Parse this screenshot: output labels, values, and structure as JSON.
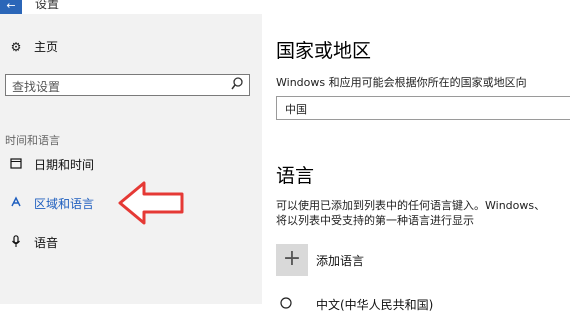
{
  "titlebar": {
    "back_icon": "←",
    "title": "设置"
  },
  "sidebar": {
    "home": {
      "icon": "gear-icon",
      "label": "主页"
    },
    "search_placeholder": "查找设置",
    "section": "时间和语言",
    "items": [
      {
        "icon": "calendar-clock-icon",
        "label": "日期和时间"
      },
      {
        "icon": "region-language-icon",
        "label": "区域和语言",
        "active": true
      },
      {
        "icon": "microphone-icon",
        "label": "语音"
      }
    ]
  },
  "main": {
    "region_title": "国家或地区",
    "region_desc": "Windows 和应用可能会根据你所在的国家或地区向",
    "region_value": "中国",
    "language_title": "语言",
    "language_desc_line1": "可以使用已添加到列表中的任何语言键入。Windows、",
    "language_desc_line2": "将以列表中受支持的第一种语言进行显示",
    "add_icon": "+",
    "add_language": "添加语言",
    "language_item": "中文(中华人民共和国)"
  },
  "colors": {
    "accent": "#1f5fbf",
    "annotation_arrow": "#e53935",
    "back_button": "#2b66b8"
  }
}
